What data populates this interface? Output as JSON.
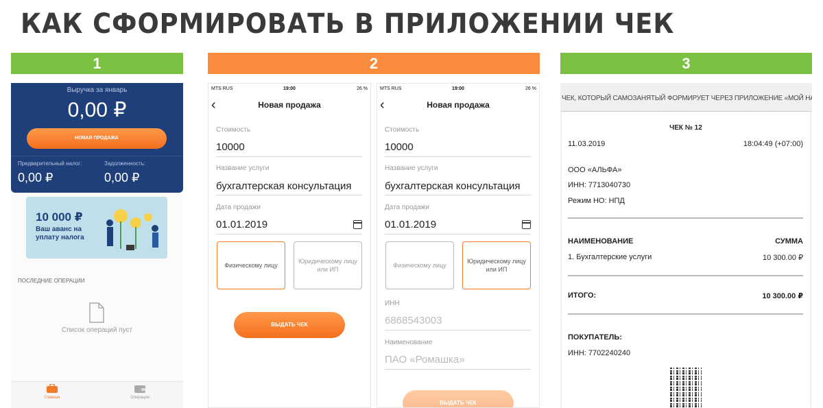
{
  "title": "КАК СФОРМИРОВАТЬ  В  ПРИЛОЖЕНИИ  ЧЕК",
  "steps": [
    "1",
    "2",
    "3"
  ],
  "colors": {
    "green": "#7ac142",
    "orange": "#fb8c3e",
    "navy": "#1f3f7a"
  },
  "screen1": {
    "revenue_label": "Выручка за январь",
    "revenue_value": "0,00 ₽",
    "new_sale_button": "НОВАЯ ПРОДАЖА",
    "tax_label": "Предварительный налог:",
    "tax_value": "0,00 ₽",
    "debt_label": "Задолженность:",
    "debt_value": "0,00 ₽",
    "banner_amount": "10 000 ₽",
    "banner_text": "Ваш аванс на уплату налога",
    "recent_label": "ПОСЛЕДНИЕ ОПЕРАЦИИ",
    "empty_text": "Список операций пуст",
    "tabs": [
      "Главная",
      "Операции"
    ]
  },
  "status_bar": {
    "carrier": "MTS RUS",
    "time": "19:00",
    "battery": "26 %"
  },
  "screen2a": {
    "nav_title": "Новая продажа",
    "cost_label": "Стоимость",
    "cost_value": "10000",
    "service_label": "Название услуги",
    "service_value": "бухгалтерская консультация",
    "date_label": "Дата продажи",
    "date_value": "01.01.2019",
    "choice_individual": "Физическому лицу",
    "choice_legal": "Юридическому лицу или ИП",
    "issue_button": "ВЫДАТЬ ЧЕК"
  },
  "screen2b": {
    "nav_title": "Новая продажа",
    "cost_label": "Стоимость",
    "cost_value": "10000",
    "service_label": "Название услуги",
    "service_value": "бухгалтерская консультация",
    "date_label": "Дата продажи",
    "date_value": "01.01.2019",
    "choice_individual": "Физическому лицу",
    "choice_legal": "Юридическому лицу или ИП",
    "inn_label": "ИНН",
    "inn_placeholder": "6868543003",
    "name_label": "Наименование",
    "name_placeholder": "ПАО «Ромашка»",
    "issue_button": "ВЫДАТЬ ЧЕК"
  },
  "receipt": {
    "header": "ЧЕК, КОТОРЫЙ САМОЗАНЯТЫЙ ФОРМИРУЕТ ЧЕРЕЗ ПРИЛОЖЕНИЕ «МОЙ НАЛОГ»",
    "number": "ЧЕК № 12",
    "date": "11.03.2019",
    "time": "18:04:49 (+07:00)",
    "seller": "ООО «АЛЬФА»",
    "seller_inn": "ИНН: 7713040730",
    "tax_mode": "Режим НО: НПД",
    "col_name": "НАИМЕНОВАНИЕ",
    "col_sum": "СУММА",
    "item_name": "1. Бухгалтерские услуги",
    "item_sum": "10 300.00 ₽",
    "total_label": "ИТОГО:",
    "total_value": "10 300.00 ₽",
    "buyer_label": "ПОКУПАТЕЛЬ:",
    "buyer_inn": "ИНН: 7702240240"
  }
}
